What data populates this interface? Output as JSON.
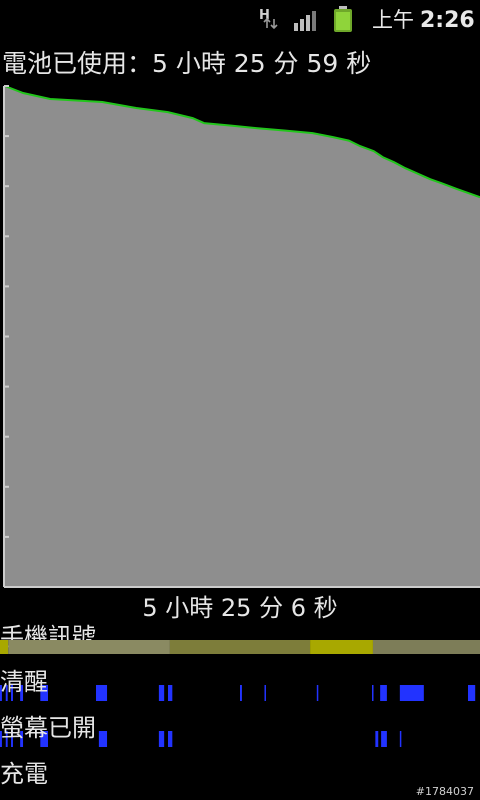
{
  "status_bar": {
    "network_type": "H",
    "network_icon": "hspa-data-icon",
    "signal_icon": "signal-strength-icon",
    "battery_icon": "battery-charging-icon",
    "ampm": "上午",
    "time": "2:26"
  },
  "battery_usage": {
    "title": "電池已使用：5 小時 25 分 59 秒",
    "duration_label": "5 小時 25 分 6 秒"
  },
  "chart_data": {
    "type": "area",
    "title": "",
    "xlabel": "",
    "ylabel": "",
    "ylim": [
      0,
      100
    ],
    "grid": false,
    "series": [
      {
        "points": [
          [
            0,
            100
          ],
          [
            8,
            98.6
          ],
          [
            20,
            97.4
          ],
          [
            43,
            96.8
          ],
          [
            58,
            95.6
          ],
          [
            72,
            94.8
          ],
          [
            83,
            93.6
          ],
          [
            88,
            92.6
          ],
          [
            100,
            92.1
          ],
          [
            111,
            91.6
          ],
          [
            124,
            91.1
          ],
          [
            136,
            90.6
          ],
          [
            145,
            89.8
          ],
          [
            152,
            89.1
          ],
          [
            157,
            88.0
          ],
          [
            163,
            87.0
          ],
          [
            167,
            85.8
          ],
          [
            172,
            84.8
          ],
          [
            177,
            83.6
          ],
          [
            183,
            82.4
          ],
          [
            188,
            81.4
          ],
          [
            193,
            80.6
          ],
          [
            200,
            79.4
          ],
          [
            210,
            77.8
          ]
        ]
      }
    ],
    "xlim": [
      0,
      210
    ],
    "colors": {
      "fill": "#8e8e8e",
      "line": "#22c51c",
      "axis": "#cccccc"
    }
  },
  "history": {
    "phone_signal": {
      "label": "手機訊號",
      "segments": [
        {
          "start": 0.0,
          "end": 0.017,
          "color": "#a8a800"
        },
        {
          "start": 0.017,
          "end": 0.354,
          "color": "#8a8a62"
        },
        {
          "start": 0.354,
          "end": 0.646,
          "color": "#7d7d3a"
        },
        {
          "start": 0.646,
          "end": 0.777,
          "color": "#a8a800"
        },
        {
          "start": 0.777,
          "end": 1.0,
          "color": "#7d7d58"
        }
      ]
    },
    "awake": {
      "label": "清醒",
      "color": "#2233ff",
      "segments": [
        [
          0.0,
          0.004
        ],
        [
          0.012,
          0.016
        ],
        [
          0.023,
          0.027
        ],
        [
          0.042,
          0.048
        ],
        [
          0.084,
          0.1
        ],
        [
          0.2,
          0.223
        ],
        [
          0.331,
          0.342
        ],
        [
          0.35,
          0.359
        ],
        [
          0.5,
          0.504
        ],
        [
          0.551,
          0.554
        ],
        [
          0.66,
          0.662
        ],
        [
          0.775,
          0.778
        ],
        [
          0.792,
          0.806
        ],
        [
          0.833,
          0.883
        ],
        [
          0.975,
          0.99
        ]
      ]
    },
    "screen_on": {
      "label": "螢幕已開",
      "color": "#2233ff",
      "segments": [
        [
          0.0,
          0.004
        ],
        [
          0.012,
          0.016
        ],
        [
          0.023,
          0.027
        ],
        [
          0.042,
          0.048
        ],
        [
          0.084,
          0.1
        ],
        [
          0.206,
          0.223
        ],
        [
          0.331,
          0.342
        ],
        [
          0.35,
          0.359
        ],
        [
          0.782,
          0.788
        ],
        [
          0.794,
          0.806
        ],
        [
          0.833,
          0.835
        ]
      ]
    },
    "charging": {
      "label": "充電"
    }
  },
  "watermark": "#1784037"
}
